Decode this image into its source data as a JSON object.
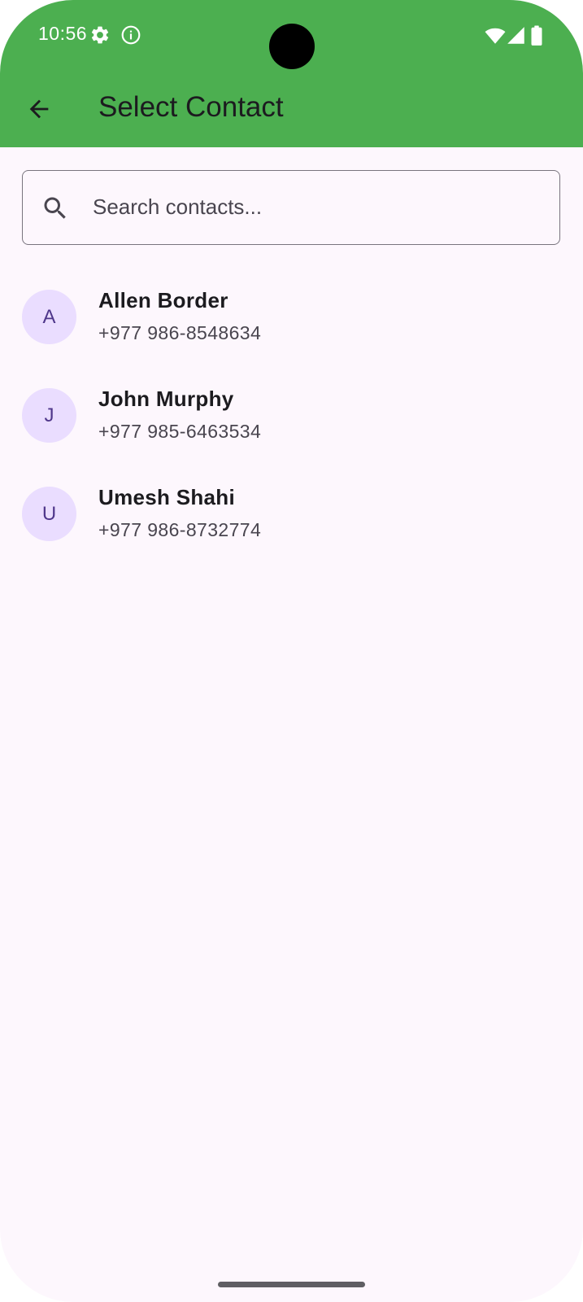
{
  "status_bar": {
    "time": "10:56",
    "left_icons": [
      "gear-icon",
      "info-icon"
    ],
    "right_icons": [
      "wifi-icon",
      "signal-icon",
      "battery-icon"
    ]
  },
  "app_bar": {
    "title": "Select Contact",
    "back_icon": "arrow-back-icon"
  },
  "search": {
    "placeholder": "Search contacts...",
    "value": "",
    "icon": "search-icon"
  },
  "contacts": [
    {
      "initial": "A",
      "name": "Allen Border",
      "phone": "+977 986-8548634"
    },
    {
      "initial": "J",
      "name": "John Murphy",
      "phone": "+977 985-6463534"
    },
    {
      "initial": "U",
      "name": "Umesh Shahi",
      "phone": "+977 986-8732774"
    }
  ],
  "colors": {
    "app_bar": "#4caf50",
    "background": "#fdf7fd",
    "avatar_bg": "#eaddff",
    "avatar_text": "#4f378b",
    "title_text": "#1c1b1f",
    "secondary_text": "#49454f"
  }
}
